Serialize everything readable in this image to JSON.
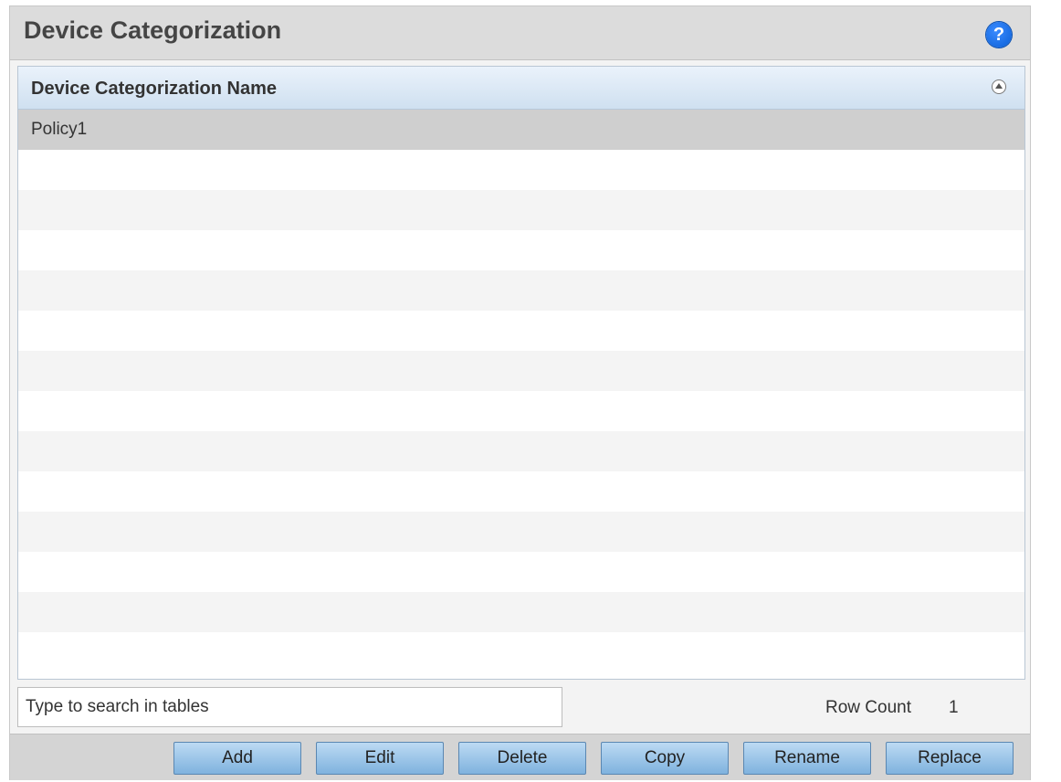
{
  "panel": {
    "title": "Device Categorization",
    "help_icon": "help-icon",
    "help_symbol": "?"
  },
  "table": {
    "column_header": "Device Categorization Name",
    "rows": [
      "Policy1"
    ]
  },
  "search": {
    "placeholder": "Type to search in tables"
  },
  "row_count": {
    "label": "Row Count",
    "value": "1"
  },
  "buttons": {
    "add": "Add",
    "edit": "Edit",
    "delete": "Delete",
    "copy": "Copy",
    "rename": "Rename",
    "replace": "Replace"
  },
  "colors": {
    "header_bg": "#dcdcdc",
    "selected_row": "#cfcfcf",
    "button_blue": "#7fb2de",
    "help_icon": "#0a5fd6"
  }
}
